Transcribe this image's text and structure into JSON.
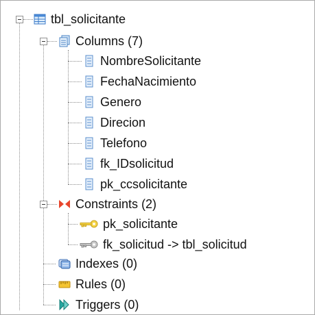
{
  "tree": {
    "table": {
      "label": "tbl_solicitante",
      "icon": "table-icon"
    },
    "columns": {
      "label": "Columns (7)",
      "icon": "columns-folder-icon",
      "items": [
        {
          "label": "NombreSolicitante",
          "icon": "column-icon"
        },
        {
          "label": "FechaNacimiento",
          "icon": "column-icon"
        },
        {
          "label": "Genero",
          "icon": "column-icon"
        },
        {
          "label": "Direcion",
          "icon": "column-icon"
        },
        {
          "label": "Telefono",
          "icon": "column-icon"
        },
        {
          "label": "fk_IDsolicitud",
          "icon": "column-icon"
        },
        {
          "label": "pk_ccsolicitante",
          "icon": "column-icon"
        }
      ]
    },
    "constraints": {
      "label": "Constraints (2)",
      "icon": "constraints-icon",
      "items": [
        {
          "label": "pk_solicitante",
          "icon": "primary-key-icon"
        },
        {
          "label": "fk_solicitud -> tbl_solicitud",
          "icon": "foreign-key-icon"
        }
      ]
    },
    "indexes": {
      "label": "Indexes (0)",
      "icon": "indexes-icon"
    },
    "rules": {
      "label": "Rules (0)",
      "icon": "rules-icon"
    },
    "triggers": {
      "label": "Triggers (0)",
      "icon": "triggers-icon"
    }
  }
}
